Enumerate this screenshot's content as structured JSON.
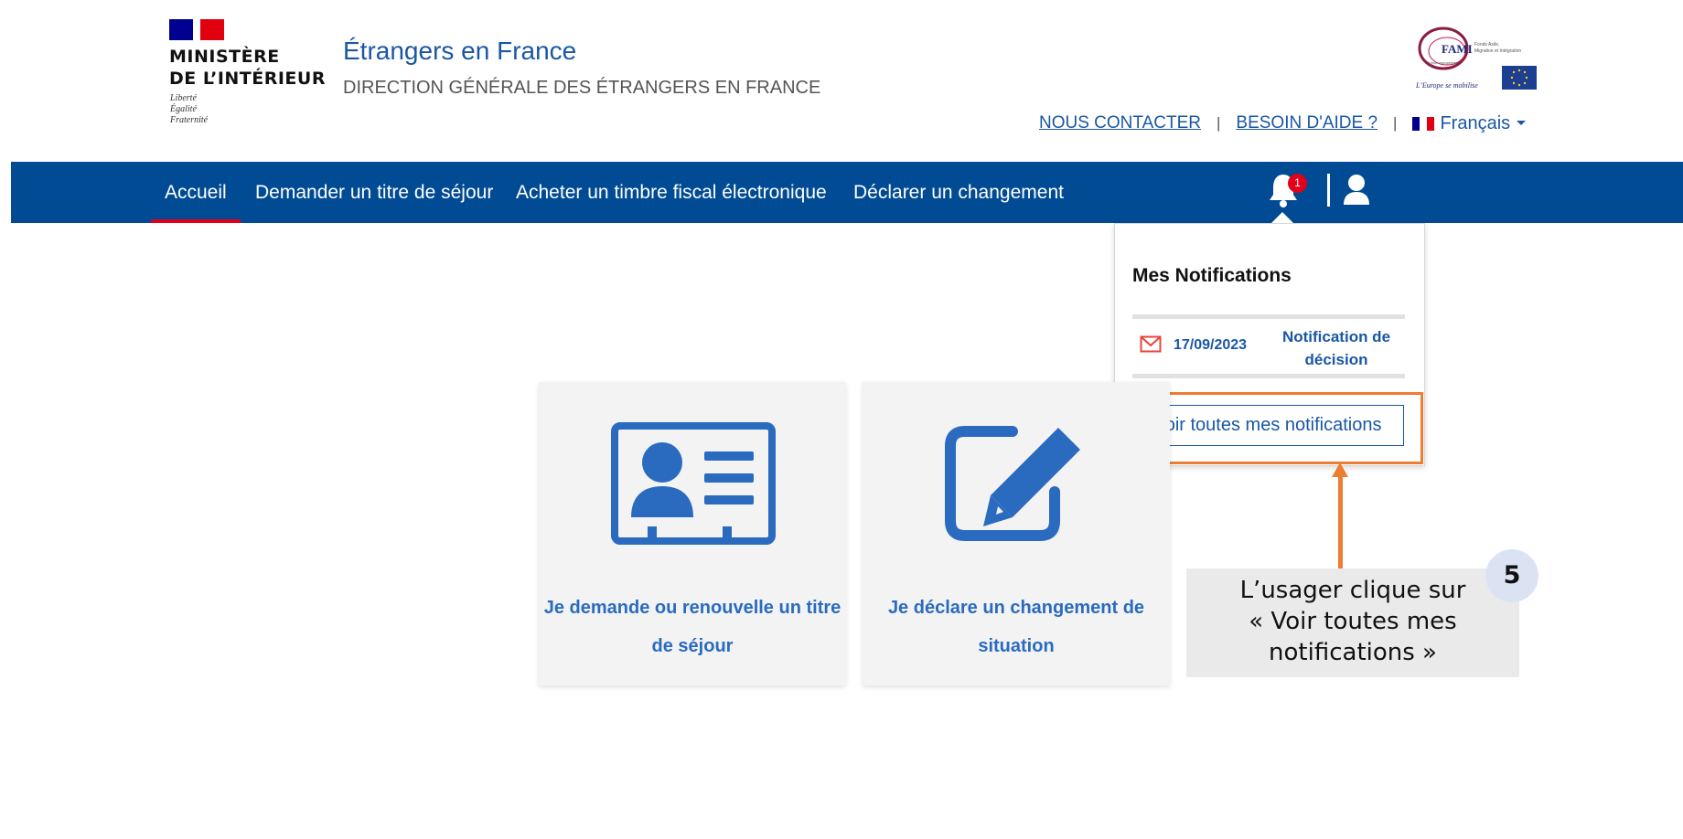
{
  "header": {
    "ministry_line1": "MINISTÈRE",
    "ministry_line2": "DE L’INTÉRIEUR",
    "devise": [
      "Liberté",
      "Égalité",
      "Fraternité"
    ],
    "site_title": "Étrangers en France",
    "site_subtitle": "DIRECTION GÉNÉRALE DES ÉTRANGERS EN FRANCE",
    "fami_logo": {
      "label": "FAMI",
      "side_text": [
        "Fonds Asile,",
        "Migration et Intégration"
      ],
      "union": "Union européenne",
      "slogan": "L’Europe se mobilise"
    },
    "links": {
      "contact": "NOUS CONTACTER",
      "help": "BESOIN D'AIDE ?",
      "separator": "|",
      "language": "Français"
    }
  },
  "nav": {
    "items": [
      "Accueil",
      "Demander un titre de séjour",
      "Acheter un timbre fiscal électronique",
      "Déclarer un changement"
    ],
    "notification_count": "1",
    "icons": [
      "bell-icon",
      "user-icon"
    ]
  },
  "notifications": {
    "title": "Mes Notifications",
    "items": [
      {
        "date": "17/09/2023",
        "label_line1": "Notification de",
        "label_line2": "décision",
        "icon": "mail-icon"
      }
    ],
    "see_all": "Voir toutes mes notifications"
  },
  "cards": [
    {
      "line1": "Je demande ou renouvelle un titre",
      "line2": "de séjour",
      "icon": "id-card-icon"
    },
    {
      "line1": "Je déclare un changement de",
      "line2": "situation",
      "icon": "edit-icon"
    }
  ],
  "callout": {
    "step": "5",
    "lines": [
      "L’usager clique sur",
      "« Voir toutes mes",
      "notifications »"
    ]
  },
  "colors": {
    "nav_blue": "#004b93",
    "link_blue": "#1a57a4",
    "accent_red": "#e2001a",
    "highlight_orange": "#ed7d31"
  }
}
